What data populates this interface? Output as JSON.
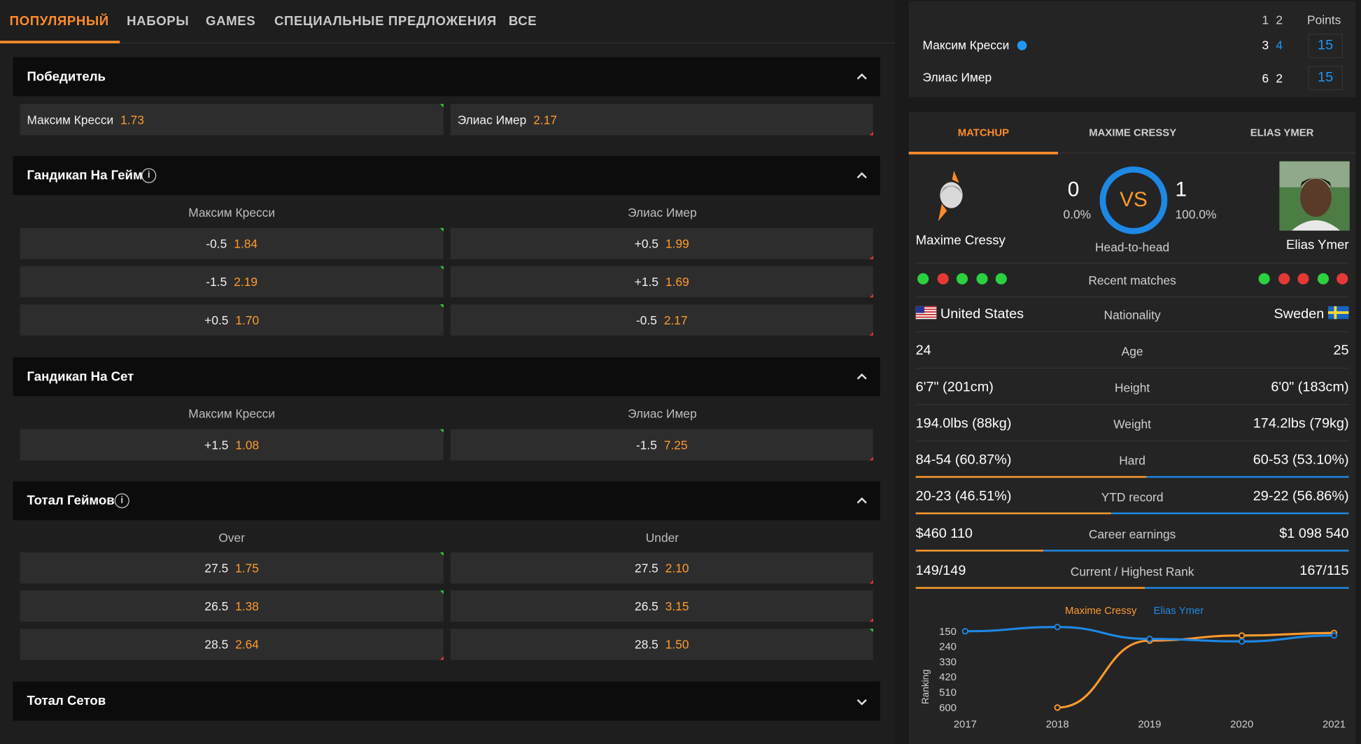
{
  "nav": {
    "tabs": [
      "ПОПУЛЯРНЫЙ",
      "НАБОРЫ",
      "GAMES",
      "СПЕЦИАЛЬНЫЕ ПРЕДЛОЖЕНИЯ",
      "ВСЕ"
    ],
    "active": 0
  },
  "winner": {
    "title": "Победитель",
    "p1_name": "Максим Кресси",
    "p1_price": "1.73",
    "p2_name": "Элиас Имер",
    "p2_price": "2.17"
  },
  "game_handicap": {
    "title": "Гандикап На Гейм",
    "col1": "Максим Кресси",
    "col2": "Элиас Имер",
    "rows": [
      {
        "l": "-0.5",
        "lp": "1.84",
        "r": "+0.5",
        "rp": "1.99"
      },
      {
        "l": "-1.5",
        "lp": "2.19",
        "r": "+1.5",
        "rp": "1.69"
      },
      {
        "l": "+0.5",
        "lp": "1.70",
        "r": "-0.5",
        "rp": "2.17"
      }
    ]
  },
  "set_handicap": {
    "title": "Гандикап На Сет",
    "col1": "Максим Кресси",
    "col2": "Элиас Имер",
    "rows": [
      {
        "l": "+1.5",
        "lp": "1.08",
        "r": "-1.5",
        "rp": "7.25"
      }
    ]
  },
  "total_games": {
    "title": "Тотал Геймов",
    "col1": "Over",
    "col2": "Under",
    "rows": [
      {
        "l": "27.5",
        "lp": "1.75",
        "r": "27.5",
        "rp": "2.10"
      },
      {
        "l": "26.5",
        "lp": "1.38",
        "r": "26.5",
        "rp": "3.15"
      },
      {
        "l": "28.5",
        "lp": "2.64",
        "r": "28.5",
        "rp": "1.50"
      }
    ]
  },
  "total_sets": {
    "title": "Тотал Сетов"
  },
  "scoreboard": {
    "set_headers": [
      "1",
      "2"
    ],
    "points_label": "Points",
    "players": [
      {
        "name": "Максим Кресси",
        "sets": [
          "3",
          "4"
        ],
        "points": "15",
        "serving": true
      },
      {
        "name": "Элиас Имер",
        "sets": [
          "6",
          "2"
        ],
        "points": "15",
        "serving": false
      }
    ]
  },
  "stats": {
    "tabs": [
      "MATCHUP",
      "MAXIME CRESSY",
      "ELIAS YMER"
    ],
    "active_tab": 0,
    "p1": {
      "name": "Maxime Cressy",
      "wins": "0",
      "pct": "0.0%"
    },
    "p2": {
      "name": "Elias Ymer",
      "wins": "1",
      "pct": "100.0%"
    },
    "vs": "VS",
    "h2h_label": "Head-to-head",
    "recent_label": "Recent matches",
    "p1_recent": [
      "win",
      "loss",
      "win",
      "win",
      "win"
    ],
    "p2_recent": [
      "win",
      "loss",
      "loss",
      "win",
      "loss"
    ],
    "colors": {
      "win": "#2bd13e",
      "loss": "#e53935",
      "orange": "#ff9a2e",
      "blue": "#1e88e5"
    },
    "rows": [
      {
        "label": "Nationality",
        "left": "United States",
        "right": "Sweden"
      },
      {
        "label": "Age",
        "left": "24",
        "right": "25"
      },
      {
        "label": "Height",
        "left": "6'7\" (201cm)",
        "right": "6'0\" (183cm)"
      },
      {
        "label": "Weight",
        "left": "194.0lbs (88kg)",
        "right": "174.2lbs (79kg)"
      },
      {
        "label": "Hard",
        "left": "84-54 (60.87%)",
        "right": "60-53 (53.10%)",
        "share": 0.534
      },
      {
        "label": "YTD record",
        "left": "20-23 (46.51%)",
        "right": "29-22 (56.86%)",
        "share": 0.45
      },
      {
        "label": "Career earnings",
        "left": "$460 110",
        "right": "$1 098 540",
        "share": 0.295
      },
      {
        "label": "Current / Highest Rank",
        "left": "149/149",
        "right": "167/115",
        "share": 0.53
      }
    ]
  },
  "chart_data": {
    "type": "line",
    "x": [
      "2017",
      "2018",
      "2019",
      "2020",
      "2021"
    ],
    "ylabel": "Ranking",
    "yticks": [
      "150",
      "240",
      "330",
      "420",
      "510",
      "600"
    ],
    "ylim": [
      600,
      150
    ],
    "series": [
      {
        "name": "Maxime Cressy",
        "color": "#ff9a2e",
        "values": [
          null,
          600,
          205,
          175,
          160
        ]
      },
      {
        "name": "Elias Ymer",
        "color": "#1e88e5",
        "values": [
          150,
          125,
          195,
          210,
          175
        ]
      }
    ]
  }
}
